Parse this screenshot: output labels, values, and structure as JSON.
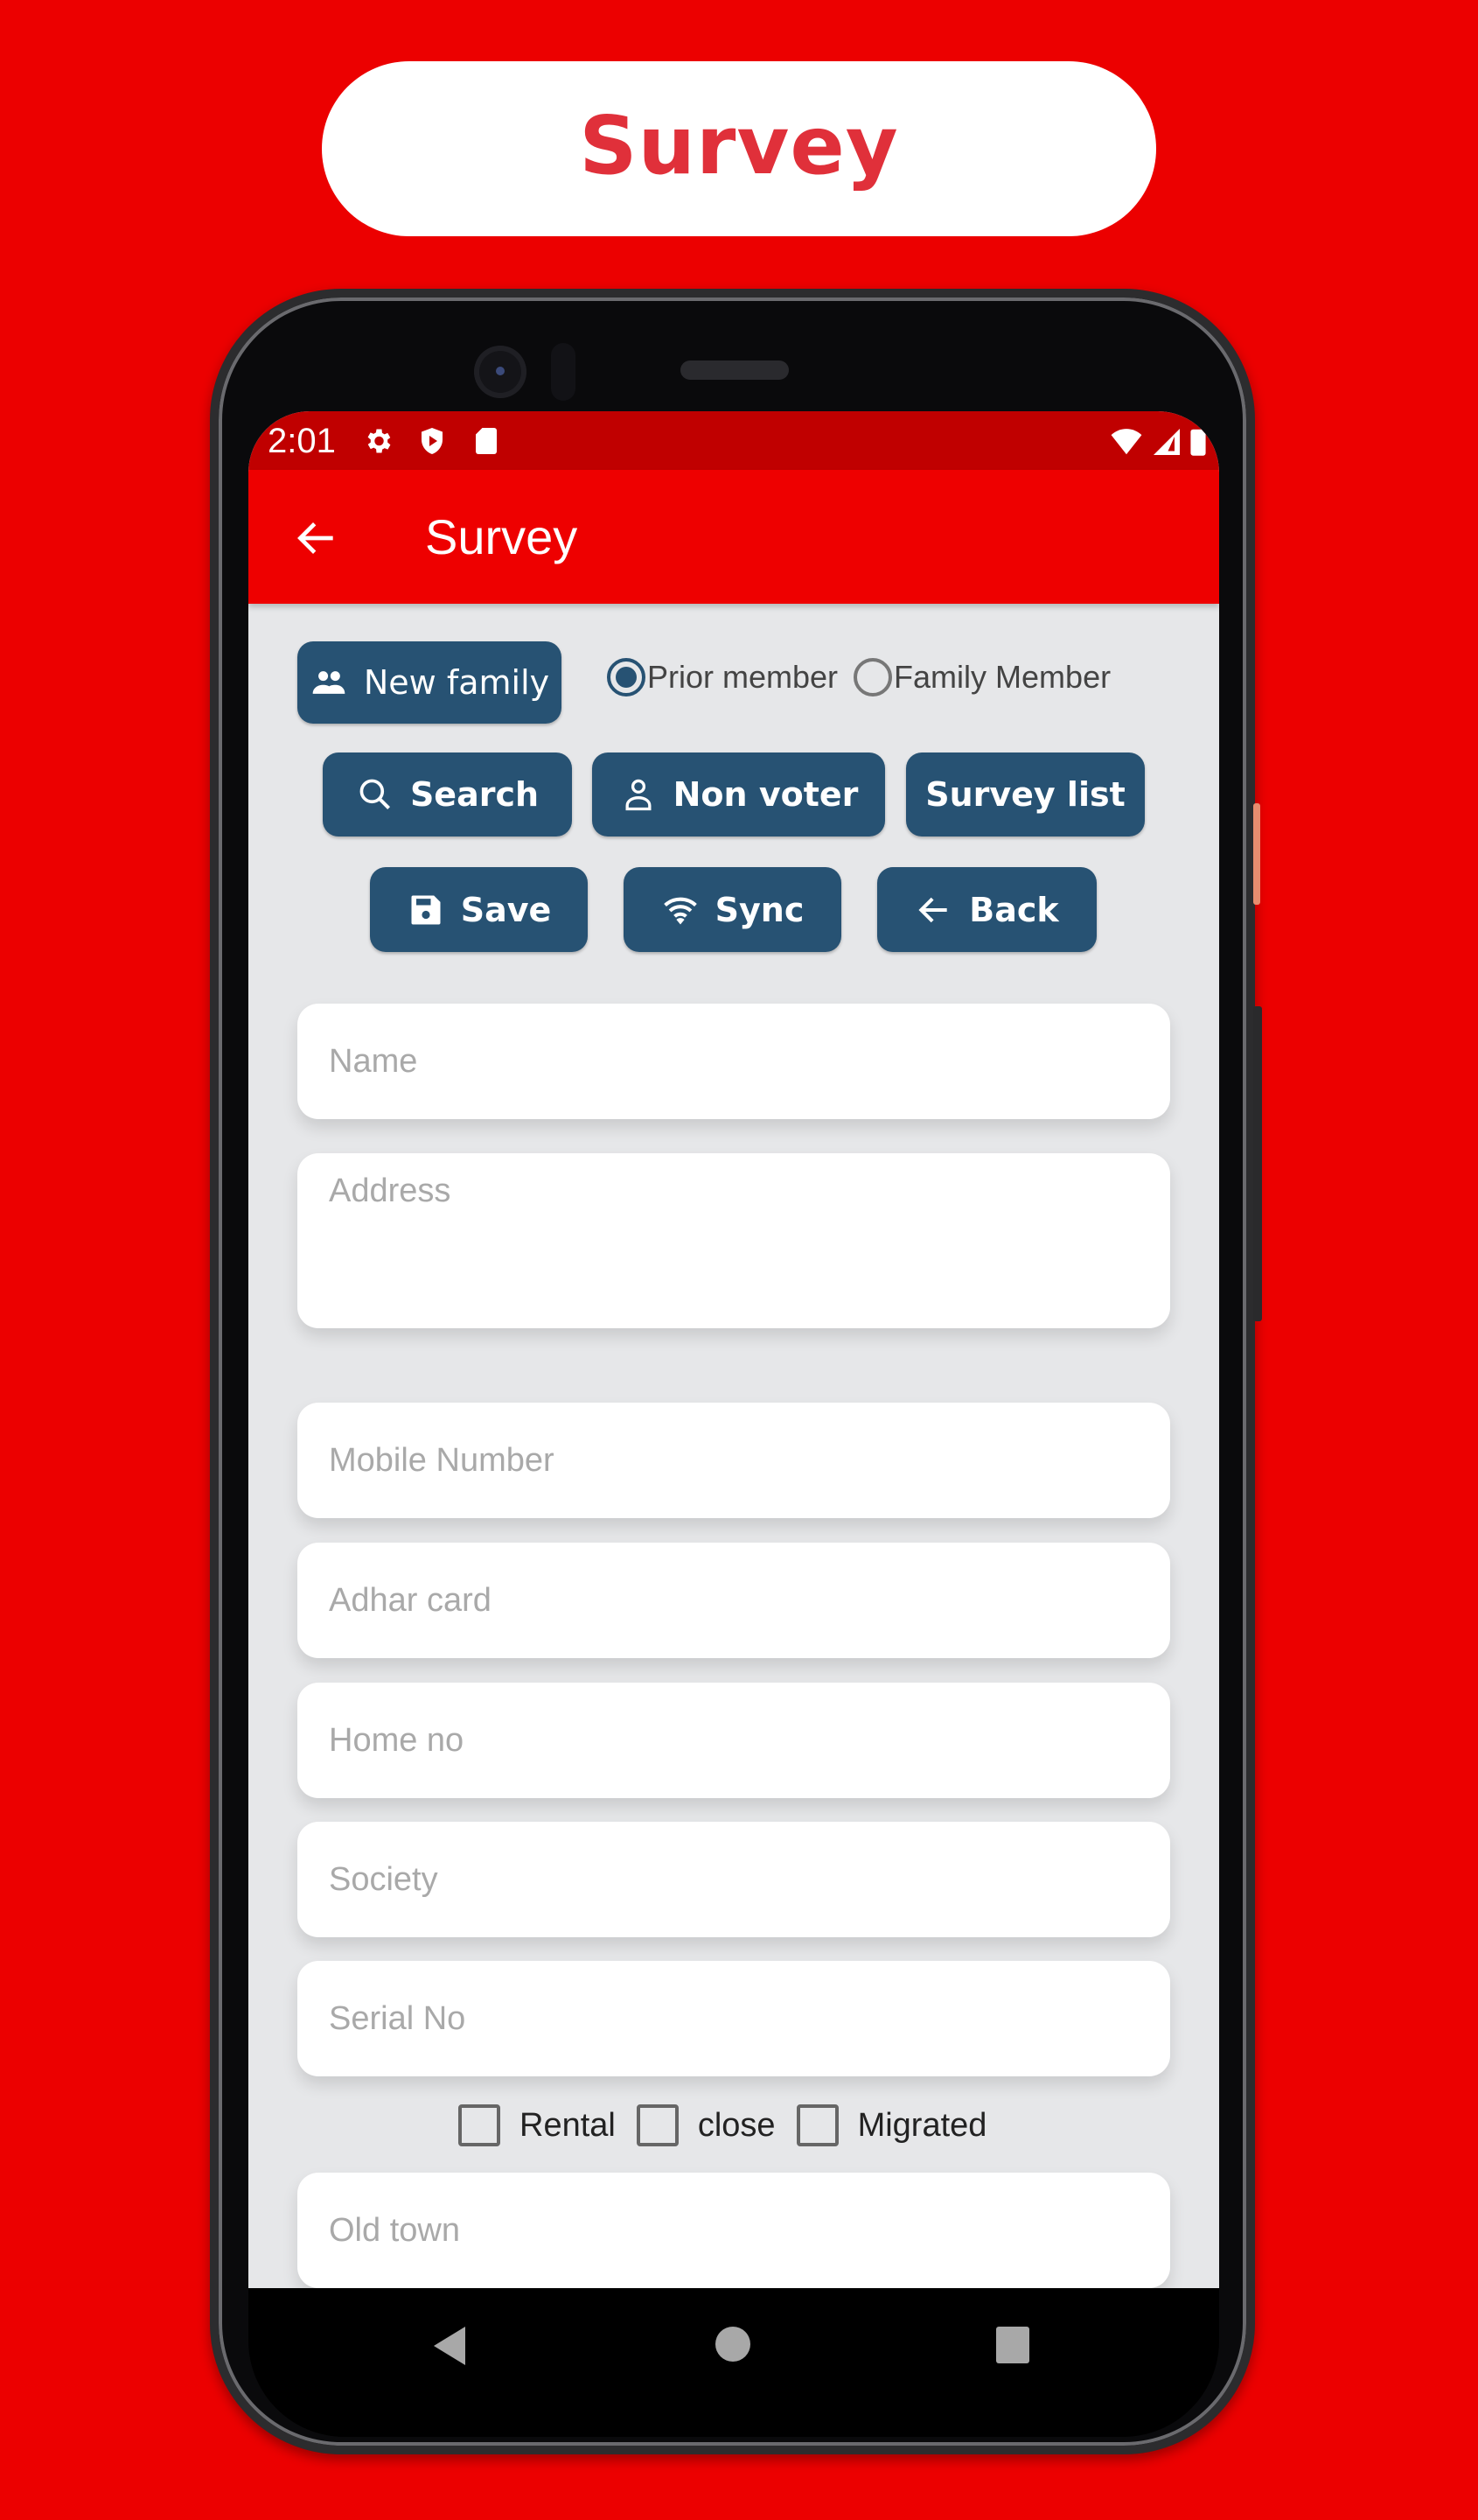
{
  "promo": {
    "title": "Survey"
  },
  "status_bar": {
    "time": "2:01",
    "left_icons": [
      "gear-icon",
      "shield-play-icon",
      "sd-card-icon"
    ],
    "right_icons": [
      "wifi-icon",
      "signal-icon",
      "battery-icon"
    ]
  },
  "app_bar": {
    "title": "Survey",
    "back_icon": "arrow-left-icon"
  },
  "toolbar": {
    "new_family": {
      "label": "New family",
      "icon": "group-icon"
    },
    "radios": [
      {
        "label": "Prior member",
        "checked": true
      },
      {
        "label": "Family Member",
        "checked": false
      }
    ],
    "search": {
      "label": "Search",
      "icon": "search-icon"
    },
    "non_voter": {
      "label": "Non voter",
      "icon": "person-icon"
    },
    "survey_list": {
      "label": "Survey list"
    },
    "save": {
      "label": "Save",
      "icon": "save-icon"
    },
    "sync": {
      "label": "Sync",
      "icon": "wifi-icon"
    },
    "back": {
      "label": "Back",
      "icon": "arrow-left-icon"
    }
  },
  "form": {
    "name": {
      "placeholder": "Name",
      "value": ""
    },
    "address": {
      "placeholder": "Address",
      "value": ""
    },
    "mobile": {
      "placeholder": "Mobile Number",
      "value": ""
    },
    "adhar": {
      "placeholder": "Adhar card",
      "value": ""
    },
    "home_no": {
      "placeholder": "Home no",
      "value": ""
    },
    "society": {
      "placeholder": "Society",
      "value": ""
    },
    "serial_no": {
      "placeholder": "Serial No",
      "value": ""
    },
    "checkboxes": [
      {
        "label": "Rental",
        "checked": false
      },
      {
        "label": "close",
        "checked": false
      },
      {
        "label": "Migrated",
        "checked": false
      }
    ],
    "old_town": {
      "placeholder": "Old town",
      "value": ""
    }
  },
  "nav_bar": {
    "icons": [
      "nav-back-icon",
      "nav-home-icon",
      "nav-recents-icon"
    ]
  },
  "colors": {
    "background": "#ec0000",
    "app_bar": "#ee0000",
    "status_bar": "#c00000",
    "button": "#275273",
    "promo_text": "#e0303a",
    "content_bg": "#e6e7e9"
  }
}
